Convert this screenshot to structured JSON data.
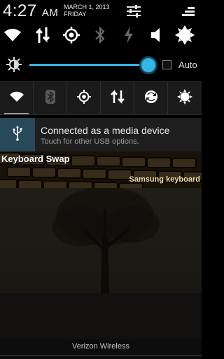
{
  "header": {
    "time": "4:27",
    "ampm": "AM",
    "date_line1": "MARCH 1, 2013",
    "date_line2": "FRIDAY",
    "icons": [
      "settings-sliders-icon",
      "clear-all-icon"
    ]
  },
  "top_toggles": [
    "wifi-icon",
    "mobile-data-icon",
    "gps-icon",
    "bluetooth-icon",
    "flight-mode-icon",
    "sound-icon",
    "brightness-auto-icon"
  ],
  "brightness": {
    "auto_label": "Auto",
    "level": 0.88,
    "auto_checked": false
  },
  "quick_settings": [
    "wifi-icon",
    "bluetooth-icon",
    "gps-icon",
    "data-sync-icon",
    "auto-rotate-icon",
    "brightness-icon"
  ],
  "notifications": {
    "usb": {
      "title": "Connected as a media device",
      "subtitle": "Touch for other USB options."
    },
    "keyboard": {
      "title": "Keyboard Swap",
      "subtitle": "Samsung keyboard"
    }
  },
  "footer": {
    "carrier": "Verizon Wireless"
  },
  "colors": {
    "accent": "#33b5e5",
    "usb_icon_bg": "#27495a"
  }
}
